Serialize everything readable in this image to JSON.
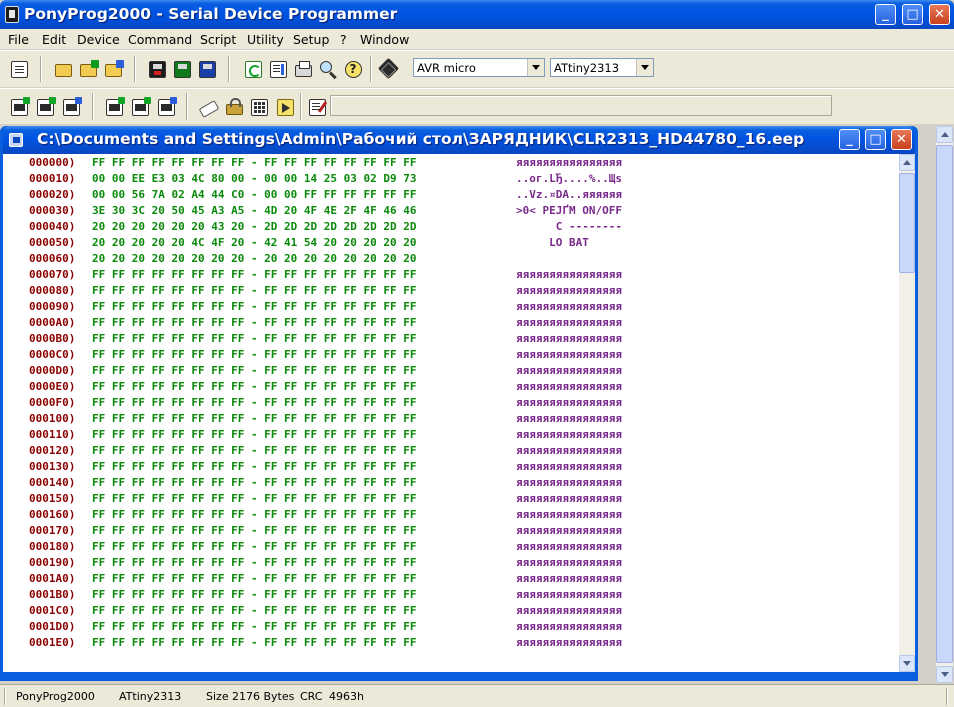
{
  "window": {
    "title": "PonyProg2000 - Serial Device Programmer",
    "minimize": "_",
    "maximize": "□",
    "close": "✕"
  },
  "menu": [
    "File",
    "Edit",
    "Device",
    "Command",
    "Script",
    "Utility",
    "Setup",
    "?",
    "Window"
  ],
  "toolbar": {
    "device_family": "AVR micro",
    "device_type": "ATtiny2313",
    "help_glyph": "?"
  },
  "child": {
    "title": "C:\\Documents and Settings\\Admin\\Рабочий стол\\ЗАРЯДНИК\\CLR2313_HD44780_16.eep",
    "minimize": "_",
    "maximize": "□",
    "close": "✕"
  },
  "hex_rows": [
    {
      "addr": "000000)",
      "bytes": "FF FF FF FF FF FF FF FF - FF FF FF FF FF FF FF FF",
      "ascii": "яяяяяяяяяяяяяяяя"
    },
    {
      "addr": "000010)",
      "bytes": "00 00 EE E3 03 4C 80 00 - 00 00 14 25 03 02 D9 73",
      "ascii": "..ог.LЂ....%..Щs"
    },
    {
      "addr": "000020)",
      "bytes": "00 00 56 7A 02 A4 44 C0 - 00 00 FF FF FF FF FF FF",
      "ascii": "..Vz.¤DА..яяяяяя"
    },
    {
      "addr": "000030)",
      "bytes": "3E 30 3C 20 50 45 A3 A5 - 4D 20 4F 4E 2F 4F 46 46",
      "ascii": ">0< PEЈҐM ON/OFF"
    },
    {
      "addr": "000040)",
      "bytes": "20 20 20 20 20 20 43 20 - 2D 2D 2D 2D 2D 2D 2D 2D",
      "ascii": "      C --------"
    },
    {
      "addr": "000050)",
      "bytes": "20 20 20 20 20 4C 4F 20 - 42 41 54 20 20 20 20 20",
      "ascii": "     LO BAT     "
    },
    {
      "addr": "000060)",
      "bytes": "20 20 20 20 20 20 20 20 - 20 20 20 20 20 20 20 20",
      "ascii": "                "
    },
    {
      "addr": "000070)",
      "bytes": "FF FF FF FF FF FF FF FF - FF FF FF FF FF FF FF FF",
      "ascii": "яяяяяяяяяяяяяяяя"
    },
    {
      "addr": "000080)",
      "bytes": "FF FF FF FF FF FF FF FF - FF FF FF FF FF FF FF FF",
      "ascii": "яяяяяяяяяяяяяяяя"
    },
    {
      "addr": "000090)",
      "bytes": "FF FF FF FF FF FF FF FF - FF FF FF FF FF FF FF FF",
      "ascii": "яяяяяяяяяяяяяяяя"
    },
    {
      "addr": "0000A0)",
      "bytes": "FF FF FF FF FF FF FF FF - FF FF FF FF FF FF FF FF",
      "ascii": "яяяяяяяяяяяяяяяя"
    },
    {
      "addr": "0000B0)",
      "bytes": "FF FF FF FF FF FF FF FF - FF FF FF FF FF FF FF FF",
      "ascii": "яяяяяяяяяяяяяяяя"
    },
    {
      "addr": "0000C0)",
      "bytes": "FF FF FF FF FF FF FF FF - FF FF FF FF FF FF FF FF",
      "ascii": "яяяяяяяяяяяяяяяя"
    },
    {
      "addr": "0000D0)",
      "bytes": "FF FF FF FF FF FF FF FF - FF FF FF FF FF FF FF FF",
      "ascii": "яяяяяяяяяяяяяяяя"
    },
    {
      "addr": "0000E0)",
      "bytes": "FF FF FF FF FF FF FF FF - FF FF FF FF FF FF FF FF",
      "ascii": "яяяяяяяяяяяяяяяя"
    },
    {
      "addr": "0000F0)",
      "bytes": "FF FF FF FF FF FF FF FF - FF FF FF FF FF FF FF FF",
      "ascii": "яяяяяяяяяяяяяяяя"
    },
    {
      "addr": "000100)",
      "bytes": "FF FF FF FF FF FF FF FF - FF FF FF FF FF FF FF FF",
      "ascii": "яяяяяяяяяяяяяяяя"
    },
    {
      "addr": "000110)",
      "bytes": "FF FF FF FF FF FF FF FF - FF FF FF FF FF FF FF FF",
      "ascii": "яяяяяяяяяяяяяяяя"
    },
    {
      "addr": "000120)",
      "bytes": "FF FF FF FF FF FF FF FF - FF FF FF FF FF FF FF FF",
      "ascii": "яяяяяяяяяяяяяяяя"
    },
    {
      "addr": "000130)",
      "bytes": "FF FF FF FF FF FF FF FF - FF FF FF FF FF FF FF FF",
      "ascii": "яяяяяяяяяяяяяяяя"
    },
    {
      "addr": "000140)",
      "bytes": "FF FF FF FF FF FF FF FF - FF FF FF FF FF FF FF FF",
      "ascii": "яяяяяяяяяяяяяяяя"
    },
    {
      "addr": "000150)",
      "bytes": "FF FF FF FF FF FF FF FF - FF FF FF FF FF FF FF FF",
      "ascii": "яяяяяяяяяяяяяяяя"
    },
    {
      "addr": "000160)",
      "bytes": "FF FF FF FF FF FF FF FF - FF FF FF FF FF FF FF FF",
      "ascii": "яяяяяяяяяяяяяяяя"
    },
    {
      "addr": "000170)",
      "bytes": "FF FF FF FF FF FF FF FF - FF FF FF FF FF FF FF FF",
      "ascii": "яяяяяяяяяяяяяяяя"
    },
    {
      "addr": "000180)",
      "bytes": "FF FF FF FF FF FF FF FF - FF FF FF FF FF FF FF FF",
      "ascii": "яяяяяяяяяяяяяяяя"
    },
    {
      "addr": "000190)",
      "bytes": "FF FF FF FF FF FF FF FF - FF FF FF FF FF FF FF FF",
      "ascii": "яяяяяяяяяяяяяяяя"
    },
    {
      "addr": "0001A0)",
      "bytes": "FF FF FF FF FF FF FF FF - FF FF FF FF FF FF FF FF",
      "ascii": "яяяяяяяяяяяяяяяя"
    },
    {
      "addr": "0001B0)",
      "bytes": "FF FF FF FF FF FF FF FF - FF FF FF FF FF FF FF FF",
      "ascii": "яяяяяяяяяяяяяяяя"
    },
    {
      "addr": "0001C0)",
      "bytes": "FF FF FF FF FF FF FF FF - FF FF FF FF FF FF FF FF",
      "ascii": "яяяяяяяяяяяяяяяя"
    },
    {
      "addr": "0001D0)",
      "bytes": "FF FF FF FF FF FF FF FF - FF FF FF FF FF FF FF FF",
      "ascii": "яяяяяяяяяяяяяяяя"
    },
    {
      "addr": "0001E0)",
      "bytes": "FF FF FF FF FF FF FF FF - FF FF FF FF FF FF FF FF",
      "ascii": "яяяяяяяяяяяяяяяя"
    }
  ],
  "statusbar": {
    "app": "PonyProg2000",
    "device": "ATtiny2313",
    "size_label": "Size",
    "size_value": "2176 Bytes",
    "crc_label": "CRC",
    "crc_value": "4963h"
  },
  "colors": {
    "address": "#8b0000",
    "bytes": "#0a8a0a",
    "ascii": "#7a2a8a",
    "titlebar": "#0054e3"
  }
}
